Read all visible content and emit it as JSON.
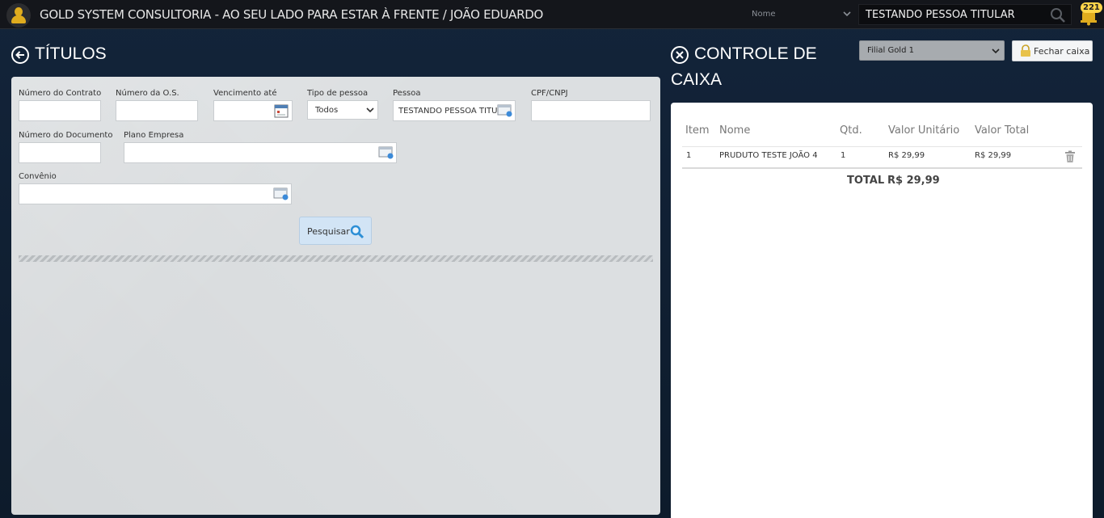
{
  "header": {
    "app_title": "GOLD SYSTEM CONSULTORIA - AO SEU LADO PARA ESTAR À FRENTE / JOÃO EDUARDO",
    "search_type": "Nome",
    "search_value": "TESTANDO PESSOA TITULAR",
    "notification_count": "221"
  },
  "titulos": {
    "title": "TÍTULOS",
    "fields": {
      "numero_contrato": {
        "label": "Número do Contrato",
        "value": ""
      },
      "numero_os": {
        "label": "Número da O.S.",
        "value": ""
      },
      "vencimento_ate": {
        "label": "Vencimento até",
        "value": ""
      },
      "tipo_pessoa": {
        "label": "Tipo de pessoa",
        "value": "Todos"
      },
      "pessoa": {
        "label": "Pessoa",
        "value": "TESTANDO PESSOA TITULAR"
      },
      "cpf_cnpj": {
        "label": "CPF/CNPJ",
        "value": ""
      },
      "numero_documento": {
        "label": "Número do Documento",
        "value": ""
      },
      "plano_empresa": {
        "label": "Plano Empresa",
        "value": ""
      },
      "convenio": {
        "label": "Convênio",
        "value": ""
      }
    },
    "search_button": "Pesquisar"
  },
  "controle_caixa": {
    "title_line1": "CONTROLE DE",
    "title_line2": "CAIXA",
    "branch": "Filial Gold 1",
    "close_button": "Fechar caixa",
    "columns": [
      "Item",
      "Nome",
      "Qtd.",
      "Valor Unitário",
      "Valor Total"
    ],
    "rows": [
      {
        "item": "1",
        "nome": "PRUDUTO TESTE JOÃO 4",
        "qtd": "1",
        "valor_unitario": "R$ 29,99",
        "valor_total": "R$ 29,99"
      }
    ],
    "total_label": "TOTAL",
    "total_value": "R$ 29,99"
  },
  "colors": {
    "background": "#0f1d2e",
    "topbar": "#14161b",
    "accent_gold": "#e0ac1e",
    "panel_light": "#dcdfe1"
  }
}
